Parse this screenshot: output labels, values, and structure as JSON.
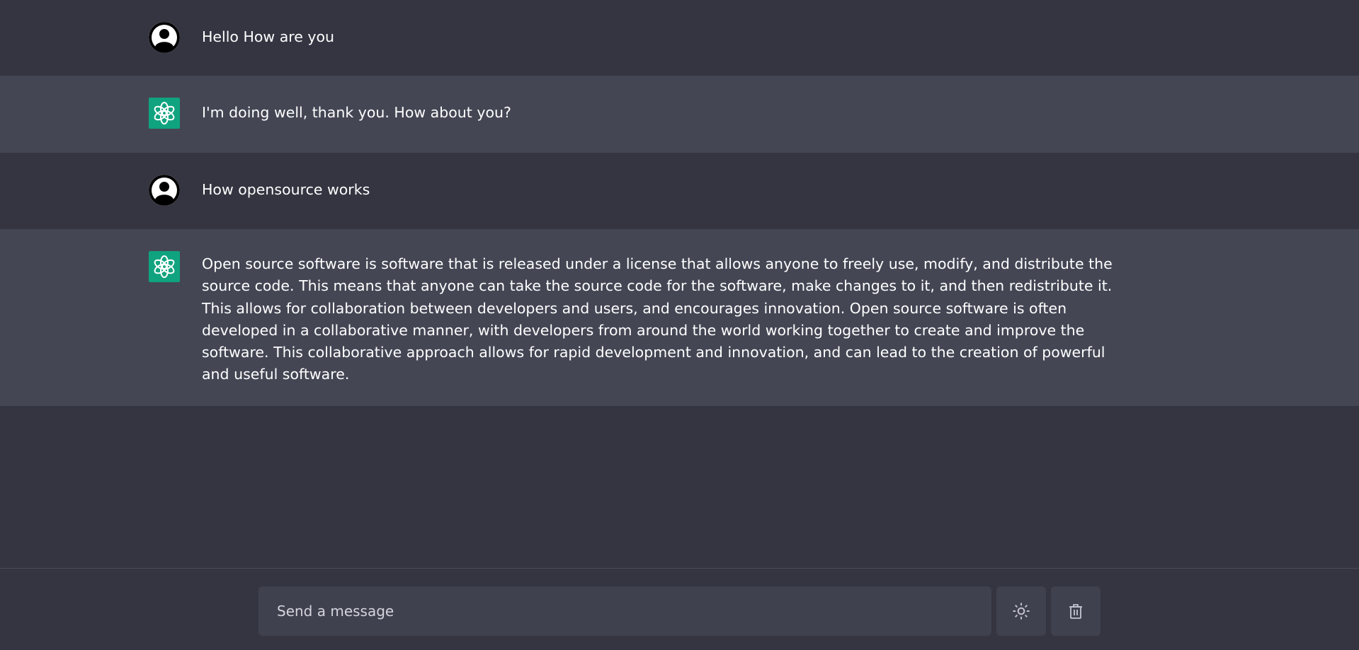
{
  "messages": [
    {
      "role": "user",
      "avatar_icon": "user-avatar-icon",
      "text": "Hello How are you"
    },
    {
      "role": "assistant",
      "avatar_icon": "openai-logo-icon",
      "text": "I'm doing well, thank you. How about you?"
    },
    {
      "role": "user",
      "avatar_icon": "user-avatar-icon",
      "text": "How opensource works"
    },
    {
      "role": "assistant",
      "avatar_icon": "openai-logo-icon",
      "text": "Open source software is software that is released under a license that allows anyone to freely use, modify, and distribute the source code. This means that anyone can take the source code for the software, make changes to it, and then redistribute it. This allows for collaboration between developers and users, and encourages innovation. Open source software is often developed in a collaborative manner, with developers from around the world working together to create and improve the software. This collaborative approach allows for rapid development and innovation, and can lead to the creation of powerful and useful software."
    }
  ],
  "composer": {
    "placeholder": "Send a message",
    "value": "",
    "theme_button_icon": "sun-icon",
    "clear_button_icon": "trash-icon"
  },
  "colors": {
    "background": "#343541",
    "assistant_row": "#444654",
    "input_background": "#40414f",
    "brand": "#10a37f",
    "text": "#ffffff"
  }
}
